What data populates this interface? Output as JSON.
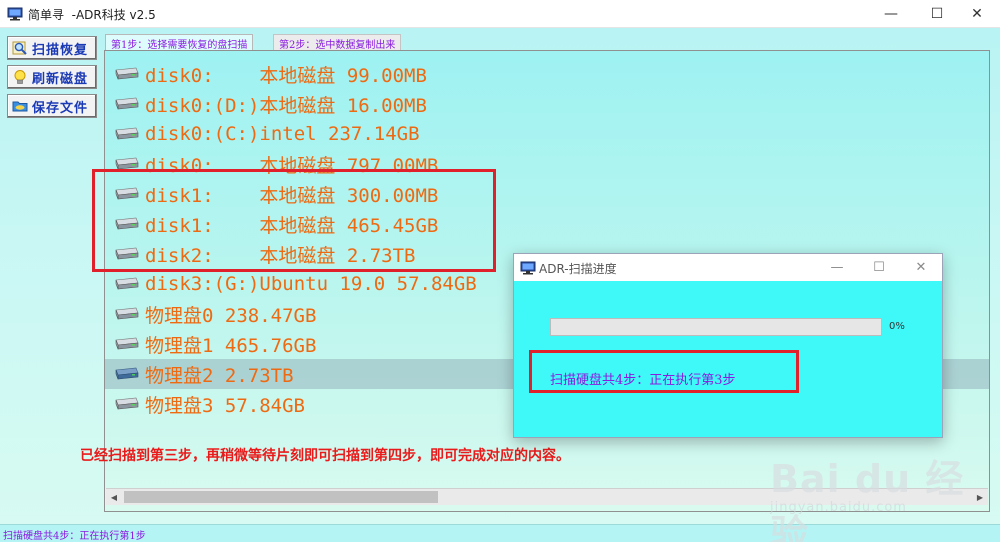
{
  "window": {
    "title": "简单寻  -ADR科技 v2.5",
    "minimize_glyph": "—",
    "maximize_glyph": "☐",
    "close_glyph": "✕"
  },
  "sidebar": {
    "buttons": [
      {
        "label": "扫描恢复",
        "icon": "magnifier-icon"
      },
      {
        "label": "刷新磁盘",
        "icon": "lightbulb-icon"
      },
      {
        "label": "保存文件",
        "icon": "folder-icon"
      }
    ]
  },
  "tabs": [
    {
      "label": "第1步：选择需要恢复的盘扫描",
      "active": true
    },
    {
      "label": "第2步：选中数据复制出来",
      "active": false
    }
  ],
  "disks": [
    {
      "text": "disk0:    本地磁盘 99.00MB",
      "selected": false
    },
    {
      "text": "disk0:(D:)本地磁盘 16.00MB",
      "selected": false
    },
    {
      "text": "disk0:(C:)intel 237.14GB",
      "selected": false
    },
    {
      "text": "disk0:    本地磁盘 797.00MB",
      "selected": false
    },
    {
      "text": "disk1:    本地磁盘 300.00MB",
      "selected": false
    },
    {
      "text": "disk1:    本地磁盘 465.45GB",
      "selected": false
    },
    {
      "text": "disk2:    本地磁盘 2.73TB",
      "selected": false
    },
    {
      "text": "disk3:(G:)Ubuntu 19.0 57.84GB",
      "selected": false
    },
    {
      "text": "物理盘0 238.47GB",
      "selected": false
    },
    {
      "text": "物理盘1 465.76GB",
      "selected": false
    },
    {
      "text": "物理盘2 2.73TB",
      "selected": true
    },
    {
      "text": "物理盘3 57.84GB",
      "selected": false
    }
  ],
  "status_bar": {
    "text": "扫描硬盘共4步：正在执行第1步"
  },
  "annotation": {
    "text": "已经扫描到第三步，再稍微等待片刻即可扫描到第四步，即可完成对应的内容。"
  },
  "dialog": {
    "title": "ADR-扫描进度",
    "progress_percent": 0,
    "progress_text": "0%",
    "status_text": "扫描硬盘共4步：正在执行第3步"
  },
  "watermark": {
    "main": "Bai du 经验",
    "sub": "jingyan.baidu.com"
  },
  "colors": {
    "disk_text": "#ee6a12",
    "accent_purple": "#8a1be0",
    "annotation_red": "#e0202a",
    "dialog_bg": "#3ff9f9"
  }
}
